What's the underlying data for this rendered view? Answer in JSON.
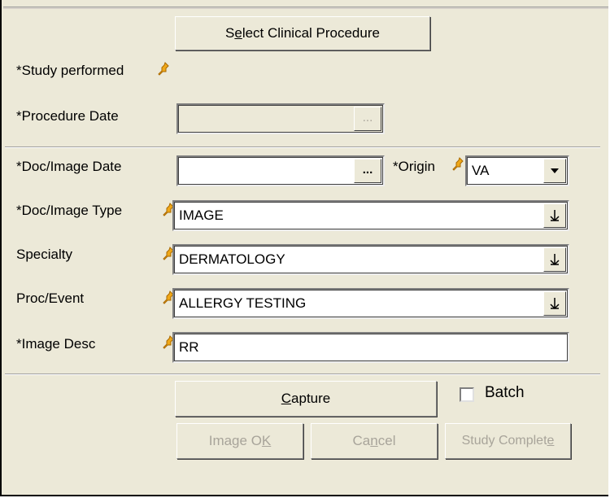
{
  "buttons": {
    "select_clinical_procedure": {
      "pre": "S",
      "mnemonic": "e",
      "post": "lect Clinical Procedure"
    },
    "capture": {
      "pre": "",
      "mnemonic": "C",
      "post": "apture"
    },
    "image_ok": {
      "pre": "Image O",
      "mnemonic": "K",
      "post": ""
    },
    "cancel": {
      "pre": "Ca",
      "mnemonic": "n",
      "post": "cel"
    },
    "study_complete": {
      "pre": "Study Complet",
      "mnemonic": "e",
      "post": ""
    }
  },
  "labels": {
    "study_performed": "*Study performed",
    "procedure_date": "*Procedure Date",
    "doc_image_date": "*Doc/Image Date",
    "origin": "*Origin",
    "doc_image_type": "*Doc/Image Type",
    "specialty": "Specialty",
    "proc_event": "Proc/Event",
    "image_desc": "*Image Desc",
    "batch": "Batch"
  },
  "fields": {
    "procedure_date": {
      "value": "",
      "enabled": false
    },
    "doc_image_date": {
      "value": ""
    },
    "origin": {
      "value": "VA"
    },
    "doc_image_type": {
      "value": "IMAGE"
    },
    "specialty": {
      "value": "DERMATOLOGY"
    },
    "proc_event": {
      "value": "ALLERGY TESTING"
    },
    "image_desc": {
      "value": "RR"
    }
  },
  "ellipsis_label": "...",
  "batch_checked": false,
  "icons": {
    "required_marker": "pushpin-icon",
    "lookup": "down-arrow-icon",
    "dropdown": "triangle-down-icon"
  },
  "colors": {
    "pin": "#f0a818",
    "face": "#ece9d8",
    "disabled_text": "#a8a49a"
  }
}
